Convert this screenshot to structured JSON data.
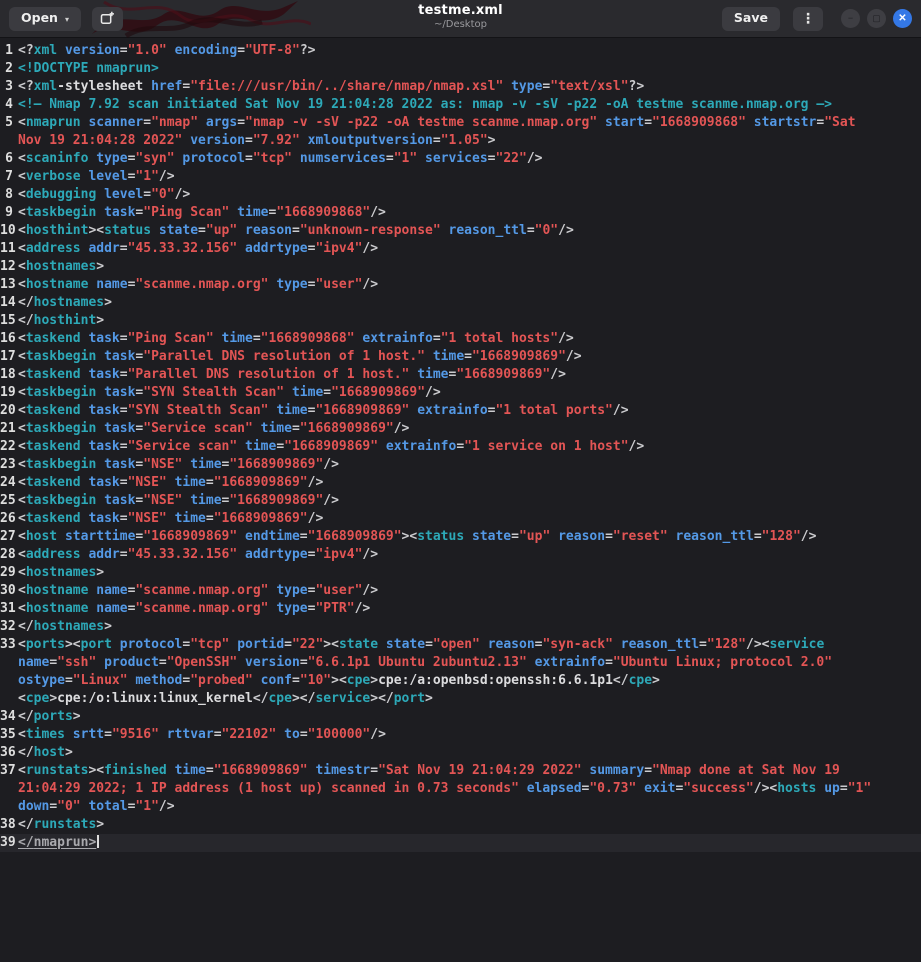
{
  "header": {
    "open_label": "Open",
    "save_label": "Save",
    "title": "testme.xml",
    "subtitle": "~/Desktop"
  },
  "icons": {
    "chevron_down": "▾",
    "tab_new": "tab-new-symbolic",
    "menu_dots": "⋮",
    "minimize": "−",
    "maximize": "▢",
    "close": "✕"
  },
  "colors": {
    "editor_bg": "#1d1d21",
    "header_bg": "#2a2a2e",
    "button_bg": "#3b3b40",
    "close_button": "#3478e6",
    "syntax_tag": "#2da9b8",
    "syntax_attr": "#5499e6",
    "syntax_string": "#e35555",
    "syntax_punct": "#cccccf",
    "syntax_text": "#dcdcde",
    "line_number": "#dedede",
    "current_line_text": "#a9a9ad",
    "current_line_bg": "#27272c",
    "title_text": "#ffffff",
    "subtitle_text": "#9a9a9e"
  },
  "code": {
    "current_line": 39,
    "lines": [
      "<?xml version=\"1.0\" encoding=\"UTF-8\"?>",
      "<!DOCTYPE nmaprun>",
      "<?xml-stylesheet href=\"file:///usr/bin/../share/nmap/nmap.xsl\" type=\"text/xsl\"?>",
      "<!— Nmap 7.92 scan initiated Sat Nov 19 21:04:28 2022 as: nmap -v -sV -p22 -oA testme scanme.nmap.org —>",
      "<nmaprun scanner=\"nmap\" args=\"nmap -v -sV -p22 -oA testme scanme.nmap.org\" start=\"1668909868\" startstr=\"Sat Nov 19 21:04:28 2022\" version=\"7.92\" xmloutputversion=\"1.05\">",
      "<scaninfo type=\"syn\" protocol=\"tcp\" numservices=\"1\" services=\"22\"/>",
      "<verbose level=\"1\"/>",
      "<debugging level=\"0\"/>",
      "<taskbegin task=\"Ping Scan\" time=\"1668909868\"/>",
      "<hosthint><status state=\"up\" reason=\"unknown-response\" reason_ttl=\"0\"/>",
      "<address addr=\"45.33.32.156\" addrtype=\"ipv4\"/>",
      "<hostnames>",
      "<hostname name=\"scanme.nmap.org\" type=\"user\"/>",
      "</hostnames>",
      "</hosthint>",
      "<taskend task=\"Ping Scan\" time=\"1668909868\" extrainfo=\"1 total hosts\"/>",
      "<taskbegin task=\"Parallel DNS resolution of 1 host.\" time=\"1668909869\"/>",
      "<taskend task=\"Parallel DNS resolution of 1 host.\" time=\"1668909869\"/>",
      "<taskbegin task=\"SYN Stealth Scan\" time=\"1668909869\"/>",
      "<taskend task=\"SYN Stealth Scan\" time=\"1668909869\" extrainfo=\"1 total ports\"/>",
      "<taskbegin task=\"Service scan\" time=\"1668909869\"/>",
      "<taskend task=\"Service scan\" time=\"1668909869\" extrainfo=\"1 service on 1 host\"/>",
      "<taskbegin task=\"NSE\" time=\"1668909869\"/>",
      "<taskend task=\"NSE\" time=\"1668909869\"/>",
      "<taskbegin task=\"NSE\" time=\"1668909869\"/>",
      "<taskend task=\"NSE\" time=\"1668909869\"/>",
      "<host starttime=\"1668909869\" endtime=\"1668909869\"><status state=\"up\" reason=\"reset\" reason_ttl=\"128\"/>",
      "<address addr=\"45.33.32.156\" addrtype=\"ipv4\"/>",
      "<hostnames>",
      "<hostname name=\"scanme.nmap.org\" type=\"user\"/>",
      "<hostname name=\"scanme.nmap.org\" type=\"PTR\"/>",
      "</hostnames>",
      "<ports><port protocol=\"tcp\" portid=\"22\"><state state=\"open\" reason=\"syn-ack\" reason_ttl=\"128\"/><service name=\"ssh\" product=\"OpenSSH\" version=\"6.6.1p1 Ubuntu 2ubuntu2.13\" extrainfo=\"Ubuntu Linux; protocol 2.0\" ostype=\"Linux\" method=\"probed\" conf=\"10\"><cpe>cpe:/a:openbsd:openssh:6.6.1p1</cpe><cpe>cpe:/o:linux:linux_kernel</cpe></service></port>",
      "</ports>",
      "<times srtt=\"9516\" rttvar=\"22102\" to=\"100000\"/>",
      "</host>",
      "<runstats><finished time=\"1668909869\" timestr=\"Sat Nov 19 21:04:29 2022\" summary=\"Nmap done at Sat Nov 19 21:04:29 2022; 1 IP address (1 host up) scanned in 0.73 seconds\" elapsed=\"0.73\" exit=\"success\"/><hosts up=\"1\" down=\"0\" total=\"1\"/>",
      "</runstats>",
      "</nmaprun>"
    ]
  }
}
